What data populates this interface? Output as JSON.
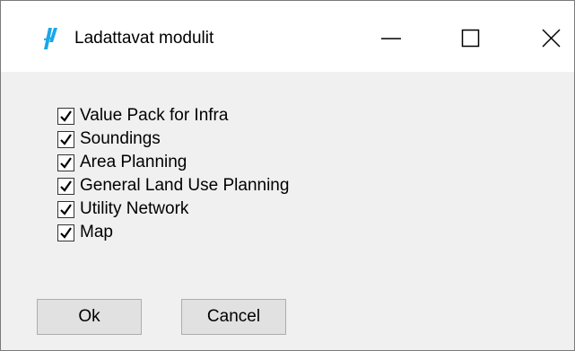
{
  "window": {
    "title": "Ladattavat modulit",
    "icon": "app-logo-icon",
    "controls": [
      "minimize-icon",
      "maximize-icon",
      "close-icon"
    ]
  },
  "modules": [
    {
      "label": "Value Pack for Infra",
      "checked": true
    },
    {
      "label": "Soundings",
      "checked": true
    },
    {
      "label": "Area Planning",
      "checked": true
    },
    {
      "label": "General Land Use Planning",
      "checked": true
    },
    {
      "label": "Utility Network",
      "checked": true
    },
    {
      "label": "Map",
      "checked": true
    }
  ],
  "buttons": {
    "ok_label": "Ok",
    "cancel_label": "Cancel"
  },
  "colors": {
    "titlebar": "#ffffff",
    "client_background": "#f0f0f0",
    "button_background": "#e1e1e1",
    "button_border": "#adadad",
    "logo_accent": "#1aa7e8"
  }
}
